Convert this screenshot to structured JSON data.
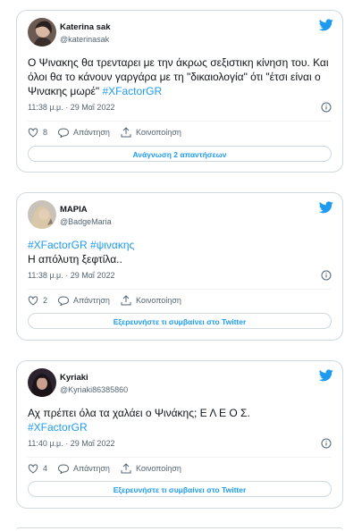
{
  "tweets": [
    {
      "name": "Katerina sak",
      "handle": "@katerinasak",
      "text": "Ο Ψινακης θα τρενταρει με την άκρως σεξιστικη κίνηση του. Και όλοι θα το κάνουν γαργάρα με τη \"δικαιολογία\" ότι \"έτσι είναι ο Ψινακης μωρέ\" ",
      "hashtags": "#XFactorGR",
      "timestamp": "11:38 μ.μ. · 29 Μαΐ 2022",
      "likes": "8",
      "reply_label": "Απάντηση",
      "share_label": "Κοινοποίηση",
      "cta": "Ανάγνωση 2 απαντήσεων"
    },
    {
      "name": "ΜΑΡΙΑ",
      "handle": "@BadgeMaria",
      "hashtags": "#XFactorGR #ψινακης",
      "text": "Η απόλυτη ξεφτίλα..",
      "timestamp": "11:38 μ.μ. · 29 Μαΐ 2022",
      "likes": "2",
      "reply_label": "Απάντηση",
      "share_label": "Κοινοποίηση",
      "cta": "Εξερευνήστε τι συμβαίνει στο Twitter"
    },
    {
      "name": "Kyriaki",
      "handle": "@Kyriaki86385860",
      "text": "Αχ πρέπει όλα τα χαλάει ο Ψινάκης; Ε Λ Ε Ο Σ.",
      "hashtags": "#XFactorGR",
      "timestamp": "11:40 μ.μ. · 29 Μαΐ 2022",
      "likes": "4",
      "reply_label": "Απάντηση",
      "share_label": "Κοινοποίηση",
      "cta": "Εξερευνήστε τι συμβαίνει στο Twitter"
    }
  ],
  "colors": {
    "accent": "#1d9bf0",
    "text": "#0f1419",
    "muted": "#536471",
    "border": "#cfd9de"
  },
  "icons": [
    "twitter-bird-icon",
    "info-icon",
    "heart-icon",
    "reply-icon",
    "share-icon"
  ]
}
